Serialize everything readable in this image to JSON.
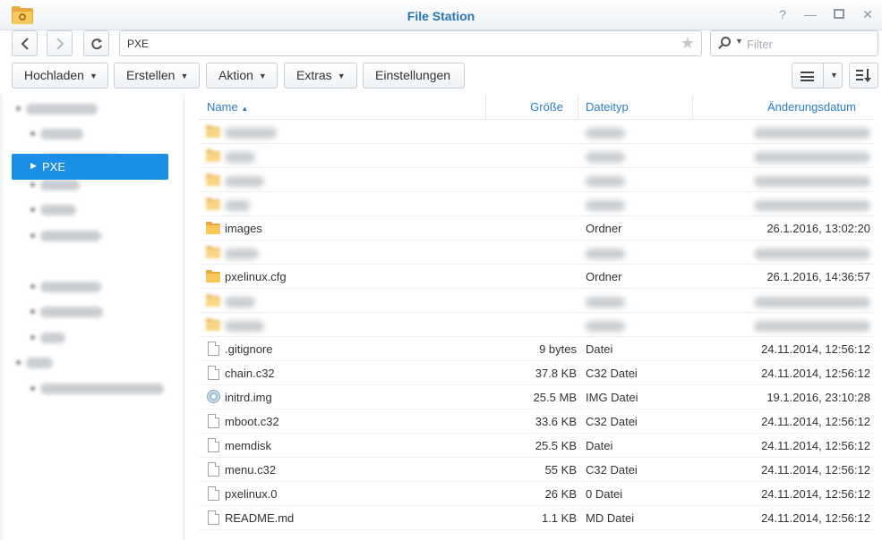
{
  "window": {
    "title": "File Station"
  },
  "navigation": {
    "path": "PXE"
  },
  "search": {
    "placeholder": "Filter"
  },
  "toolbar": {
    "upload": "Hochladen",
    "create": "Erstellen",
    "action": "Aktion",
    "extras": "Extras",
    "settings": "Einstellungen"
  },
  "sidebar": {
    "selected": "PXE"
  },
  "columns": {
    "name": "Name",
    "size": "Größe",
    "type": "Dateityp",
    "modified": "Änderungsdatum"
  },
  "files": [
    {
      "name": "images",
      "size": "",
      "type": "Ordner",
      "modified": "26.1.2016, 13:02:20"
    },
    {
      "name": "pxelinux.cfg",
      "size": "",
      "type": "Ordner",
      "modified": "26.1.2016, 14:36:57"
    },
    {
      "name": ".gitignore",
      "size": "9 bytes",
      "type": "Datei",
      "modified": "24.11.2014, 12:56:12"
    },
    {
      "name": "chain.c32",
      "size": "37.8 KB",
      "type": "C32 Datei",
      "modified": "24.11.2014, 12:56:12"
    },
    {
      "name": "initrd.img",
      "size": "25.5 MB",
      "type": "IMG Datei",
      "modified": "19.1.2016, 23:10:28"
    },
    {
      "name": "mboot.c32",
      "size": "33.6 KB",
      "type": "C32 Datei",
      "modified": "24.11.2014, 12:56:12"
    },
    {
      "name": "memdisk",
      "size": "25.5 KB",
      "type": "Datei",
      "modified": "24.11.2014, 12:56:12"
    },
    {
      "name": "menu.c32",
      "size": "55 KB",
      "type": "C32 Datei",
      "modified": "24.11.2014, 12:56:12"
    },
    {
      "name": "pxelinux.0",
      "size": "26 KB",
      "type": "0 Datei",
      "modified": "24.11.2014, 12:56:12"
    },
    {
      "name": "README.md",
      "size": "1.1 KB",
      "type": "MD Datei",
      "modified": "24.11.2014, 12:56:12"
    }
  ],
  "colors": {
    "accent": "#1b8ee6",
    "title": "#2776b4",
    "folder": "#f8c85a"
  },
  "icons": [
    "app-folder-icon",
    "help-icon",
    "minimize-icon",
    "maximize-icon",
    "close-icon",
    "back-icon",
    "forward-icon",
    "refresh-icon",
    "star-icon",
    "search-icon",
    "list-view-icon",
    "sort-icon",
    "folder-icon",
    "file-icon",
    "disc-image-icon"
  ]
}
